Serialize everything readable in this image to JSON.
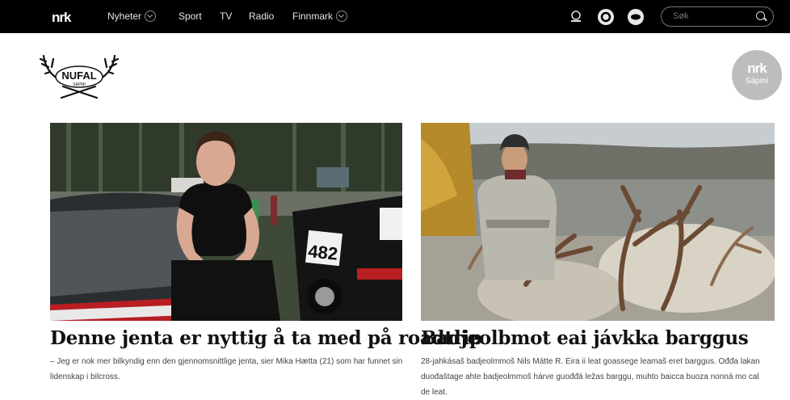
{
  "header": {
    "logo": "nrk",
    "nav": [
      {
        "label": "Nyheter",
        "has_dropdown": true
      },
      {
        "label": "Sport",
        "has_dropdown": false
      },
      {
        "label": "TV",
        "has_dropdown": false
      },
      {
        "label": "Radio",
        "has_dropdown": false
      },
      {
        "label": "Finnmark",
        "has_dropdown": true
      }
    ],
    "icons": [
      "user-icon",
      "super-icon",
      "p3-icon"
    ],
    "search": {
      "placeholder": "Søk"
    }
  },
  "brand": {
    "nufal": "NUFAL",
    "nufal_sub": "SÁPMI",
    "nrk_sapmi_logo": "nrk",
    "nrk_sapmi_sub": "Sápmi"
  },
  "articles": [
    {
      "title": "Denne jenta er nyttig å ta med på roadtrip",
      "lead": "– Jeg er nok mer bilkyndig enn den gjennomsnittlige jenta, sier Mika Hætta (21) som har funnet sin lidenskap i bilcross.",
      "car_number": "482"
    },
    {
      "title": "Badjeolbmot eai jávkka barggus",
      "lead": "28-jahkásaš badjeolmmoš Nils Mátte R. Eira ii leat goassege leamaš eret barggus. Ođđa lakan duođaštage ahte badjeolmmoš hárve guođđá ležas barggu, muhto baicca buoza nonná mo cal de leat."
    }
  ],
  "colors": {
    "topbar": "#000000",
    "accent": "#bdbdbd"
  }
}
